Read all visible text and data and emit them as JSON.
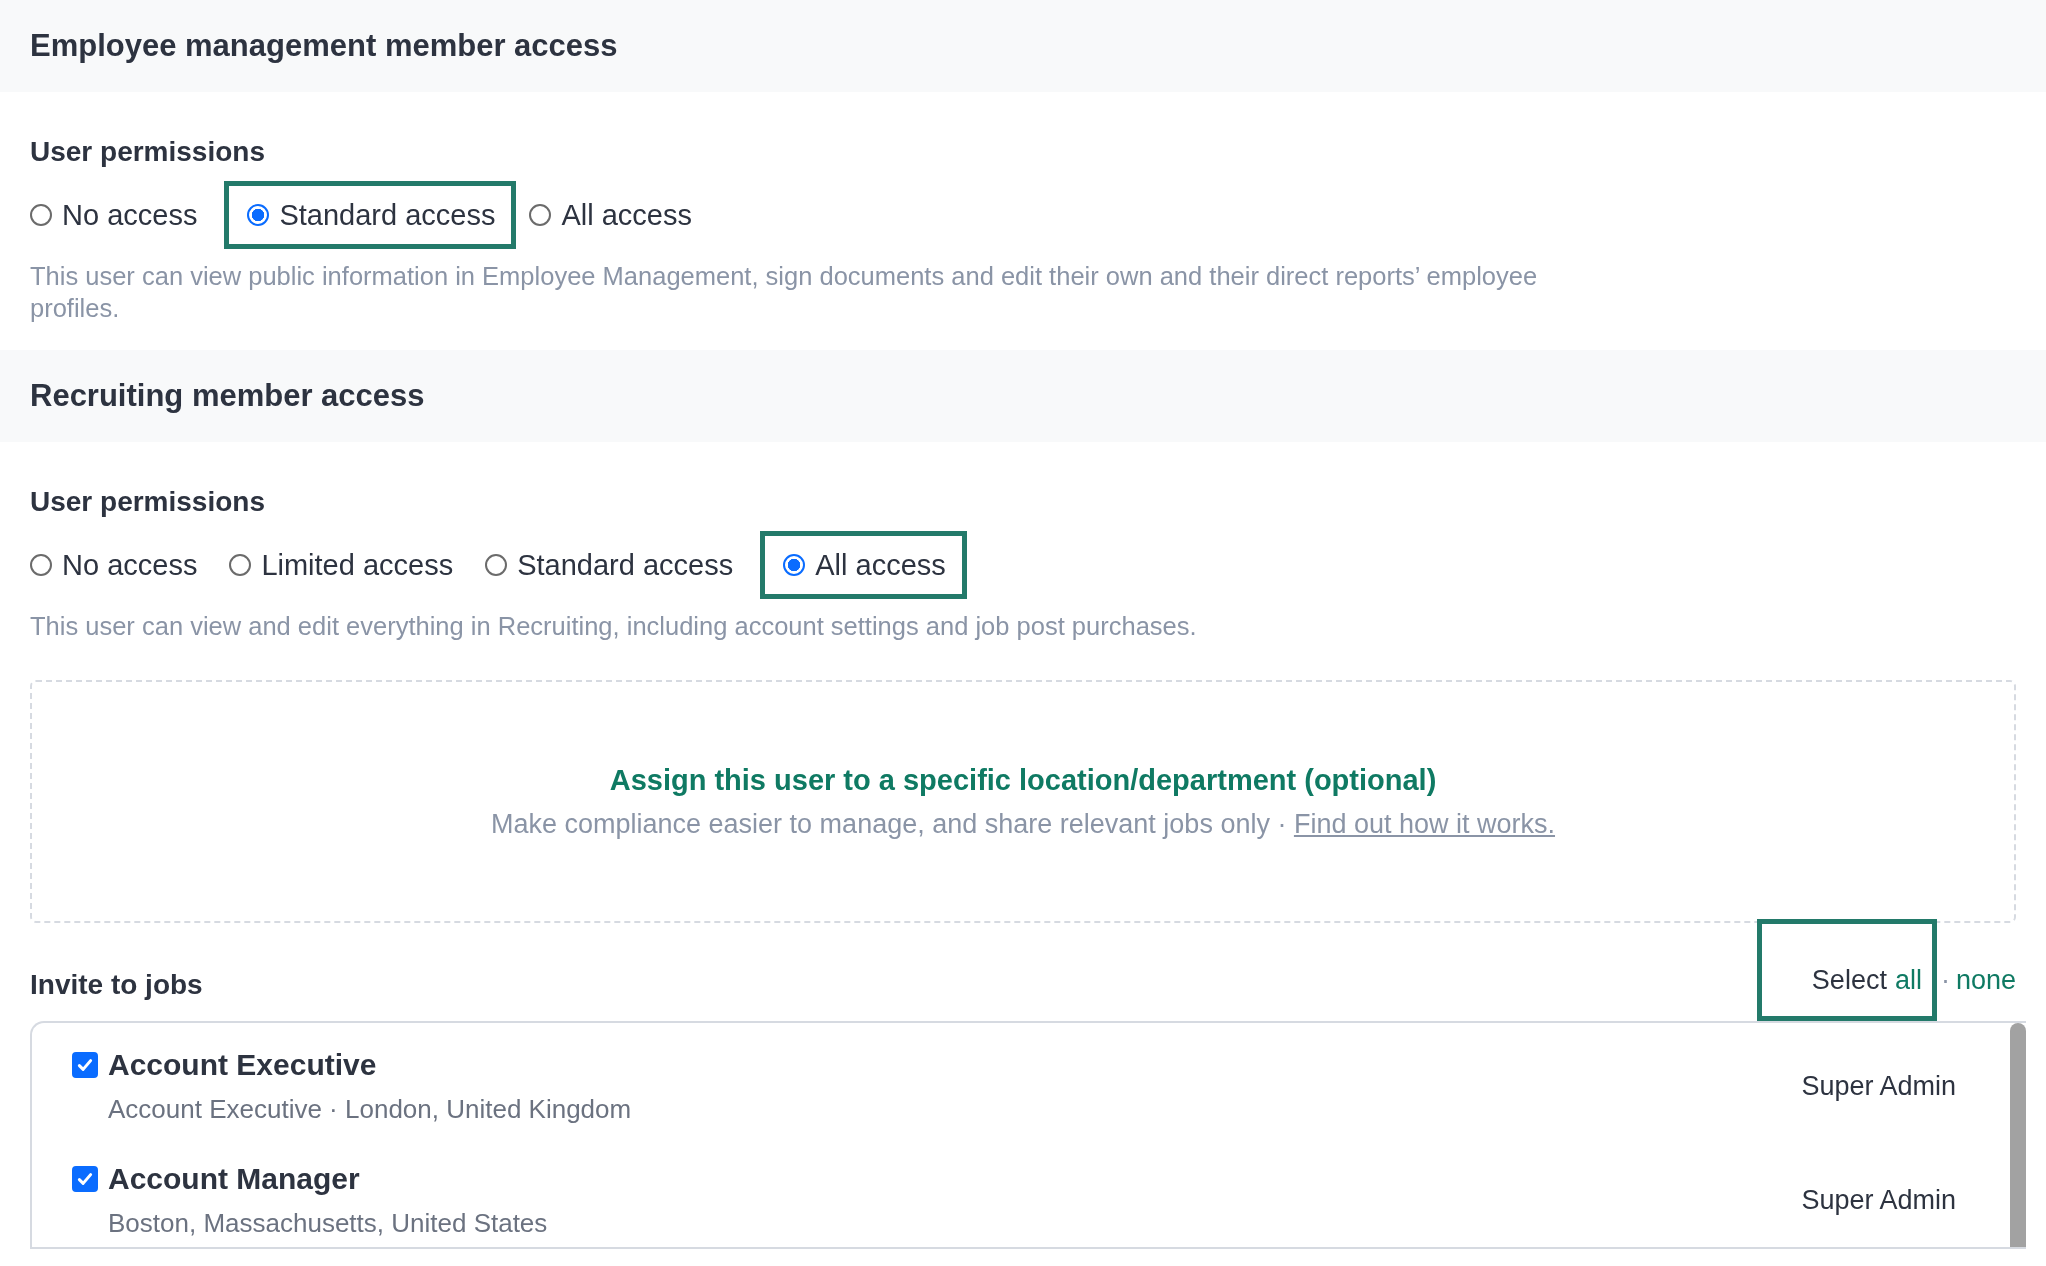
{
  "sections": [
    {
      "title": "Employee management member access",
      "permissions_label": "User permissions",
      "options": [
        {
          "label": "No access",
          "selected": false,
          "highlighted": false
        },
        {
          "label": "Standard access",
          "selected": true,
          "highlighted": true
        },
        {
          "label": "All access",
          "selected": false,
          "highlighted": false
        }
      ],
      "description": "This user can view public information in Employee Management, sign documents and edit their own and their direct reports’ employee profiles."
    },
    {
      "title": "Recruiting member access",
      "permissions_label": "User permissions",
      "options": [
        {
          "label": "No access",
          "selected": false,
          "highlighted": false
        },
        {
          "label": "Limited access",
          "selected": false,
          "highlighted": false
        },
        {
          "label": "Standard access",
          "selected": false,
          "highlighted": false
        },
        {
          "label": "All access",
          "selected": true,
          "highlighted": true
        }
      ],
      "description": "This user can view and edit everything in Recruiting, including account settings and job post purchases."
    }
  ],
  "assign_panel": {
    "title": "Assign this user to a specific location/department (optional)",
    "text": "Make compliance easier to manage, and share relevant jobs only ·",
    "link": "Find out how it works."
  },
  "invite": {
    "title": "Invite to jobs",
    "select_label": "Select",
    "select_all": "all",
    "separator": "·",
    "select_none": "none",
    "select_highlighted": true,
    "jobs": [
      {
        "title": "Account Executive",
        "subtitle": "Account Executive · London, United Kingdom",
        "role": "Super Admin",
        "checked": true
      },
      {
        "title": "Account Manager",
        "subtitle": "Boston, Massachusetts, United States",
        "role": "Super Admin",
        "checked": true
      }
    ]
  }
}
